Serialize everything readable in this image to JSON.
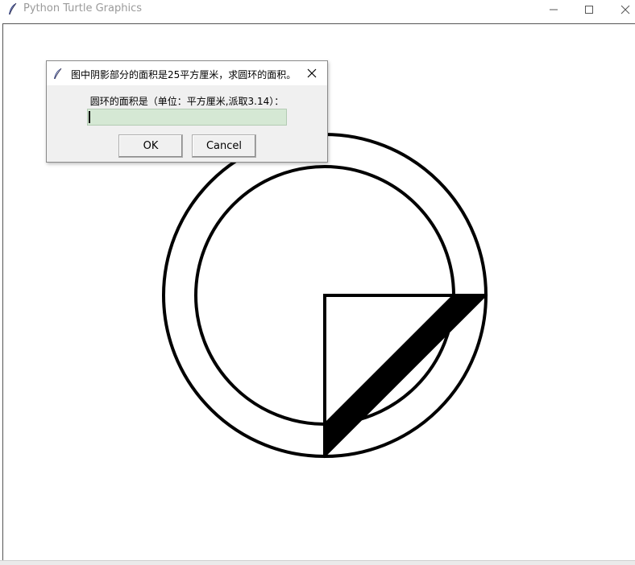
{
  "window": {
    "title": "Python Turtle Graphics",
    "icon": "feather-icon",
    "controls": [
      "minimize-icon",
      "maximize-icon",
      "close-icon"
    ]
  },
  "dialog": {
    "title": "图中阴影部分的面积是25平方厘米，求圆环的面积。",
    "prompt": "圆环的面积是（单位：平方厘米,派取3.14）：",
    "input_value": "",
    "ok_label": "OK",
    "cancel_label": "Cancel"
  },
  "colors": {
    "input_background": "#d5e8d4",
    "drawing_stroke": "#000000",
    "shaded_fill": "#000000"
  }
}
